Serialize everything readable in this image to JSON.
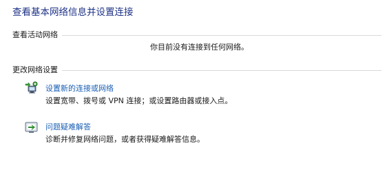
{
  "page": {
    "title": "查看基本网络信息并设置连接"
  },
  "active_networks": {
    "header": "查看活动网络",
    "status": "你目前没有连接到任何网络。"
  },
  "change_settings": {
    "header": "更改网络设置",
    "tasks": [
      {
        "icon": "network-setup-icon",
        "link": "设置新的连接或网络",
        "description": "设置宽带、拨号或 VPN 连接；或设置路由器或接入点。"
      },
      {
        "icon": "troubleshoot-icon",
        "link": "问题疑难解答",
        "description": "诊断并修复网络问题，或者获得疑难解答信息。"
      }
    ]
  },
  "colors": {
    "title": "#1e3287",
    "link": "#1a5fb4",
    "rule": "#d8d8d8"
  }
}
